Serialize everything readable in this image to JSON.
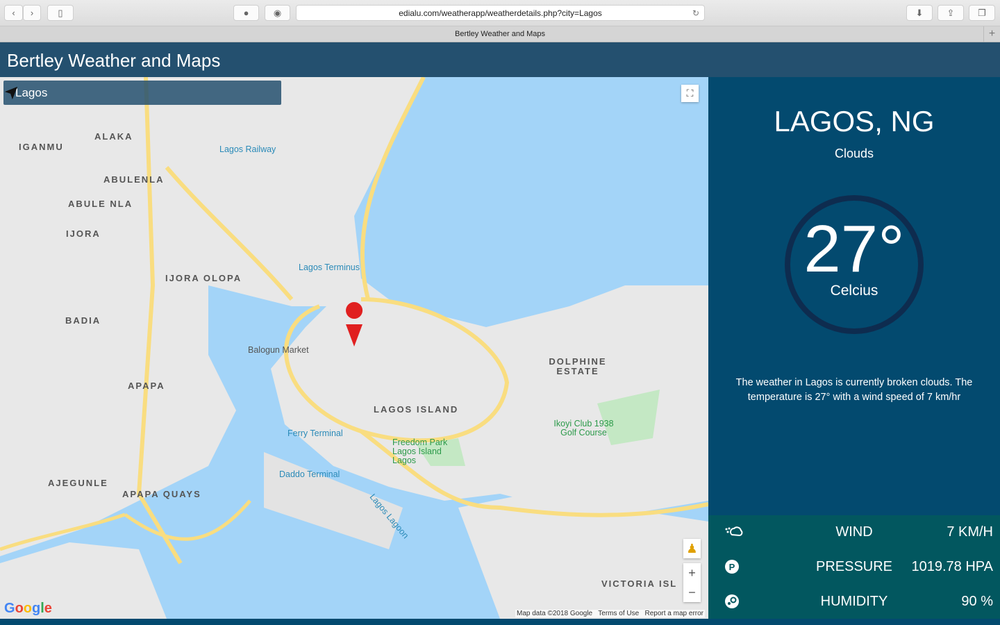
{
  "browser": {
    "url": "edialu.com/weatherapp/weatherdetails.php?city=Lagos",
    "tab_title": "Bertley Weather and Maps"
  },
  "header": {
    "title": "Bertley Weather and Maps"
  },
  "search": {
    "value": "Lagos"
  },
  "map": {
    "areas": [
      "IGANMU",
      "ALAKA",
      "ABULENLA",
      "ABULE NLA",
      "IJORA",
      "IJORA OLOPA",
      "BADIA",
      "APAPA",
      "AJEGUNLE",
      "APAPA QUAYS",
      "LAGOS ISLAND",
      "DOLPHINE ESTATE",
      "VICTORIA ISL"
    ],
    "pois": [
      "Lagos Railway",
      "Lagos Terminus",
      "Balogun Market",
      "Ferry Terminal",
      "Freedom Park Lagos Island Lagos",
      "Daddo Terminal",
      "Ikoyi Club 1938 Golf Course",
      "Lagos Lagoon"
    ],
    "attribution": "Map data ©2018 Google",
    "terms": "Terms of Use",
    "report": "Report a map error",
    "logo": "Google"
  },
  "weather": {
    "city": "LAGOS, NG",
    "condition": "Clouds",
    "temperature": "27°",
    "unit": "Celcius",
    "description": "The weather in Lagos is currently broken clouds. The temperature is 27° with a wind speed of 7 km/hr"
  },
  "stats": [
    {
      "icon": "wind-icon",
      "label": "WIND",
      "value": "7 KM/H"
    },
    {
      "icon": "pressure-icon",
      "label": "PRESSURE",
      "value": "1019.78 HPA"
    },
    {
      "icon": "humidity-icon",
      "label": "HUMIDITY",
      "value": "90 %"
    }
  ]
}
